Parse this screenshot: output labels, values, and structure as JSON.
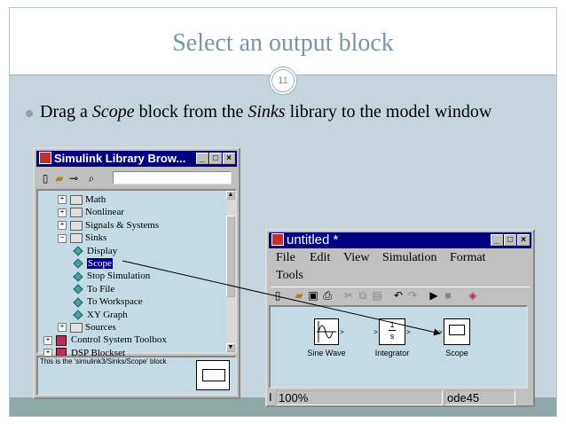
{
  "slide": {
    "title": "Select an output block",
    "page_number": "11",
    "bullet_prefix": "Drag a ",
    "bullet_italic1": "Scope",
    "bullet_mid": " block from the ",
    "bullet_italic2": "Sinks",
    "bullet_suffix": " library to the model window",
    "colors": {
      "title": "#7a96a5",
      "body_bg": "#c6d5dd",
      "footer": "#8fa9a9",
      "accent": "#000080"
    }
  },
  "library_browser": {
    "title": "Simulink Library Brow...",
    "tree": [
      {
        "label": "Math",
        "expander": "+",
        "indent": 1,
        "icon": "lib-icon"
      },
      {
        "label": "Nonlinear",
        "expander": "+",
        "indent": 1,
        "icon": "lib-icon"
      },
      {
        "label": "Signals & Systems",
        "expander": "+",
        "indent": 1,
        "icon": "lib-icon"
      },
      {
        "label": "Sinks",
        "expander": "−",
        "indent": 1,
        "icon": "lib-icon"
      },
      {
        "label": "Display",
        "expander": "",
        "indent": 2,
        "icon": "diamond"
      },
      {
        "label": "Scope",
        "expander": "",
        "indent": 2,
        "icon": "diamond",
        "selected": true
      },
      {
        "label": "Stop Simulation",
        "expander": "",
        "indent": 2,
        "icon": "diamond"
      },
      {
        "label": "To File",
        "expander": "",
        "indent": 2,
        "icon": "diamond"
      },
      {
        "label": "To Workspace",
        "expander": "",
        "indent": 2,
        "icon": "diamond"
      },
      {
        "label": "XY Graph",
        "expander": "",
        "indent": 2,
        "icon": "diamond"
      },
      {
        "label": "Sources",
        "expander": "+",
        "indent": 1,
        "icon": "lib-icon"
      },
      {
        "label": "Control System Toolbox",
        "expander": "+",
        "indent": 0,
        "icon": "toolbox-icon"
      },
      {
        "label": "DSP Blockset",
        "expander": "+",
        "indent": 0,
        "icon": "toolbox-icon"
      }
    ],
    "status": "This is the 'simulink3/Sinks/Scope' block"
  },
  "model_window": {
    "title": "untitled *",
    "menus": [
      "File",
      "Edit",
      "View",
      "Simulation",
      "Format",
      "Tools"
    ],
    "blocks": {
      "sine": "Sine Wave",
      "integrator": "Integrator",
      "integrator_num": "1",
      "integrator_den": "s",
      "scope": "Scope"
    },
    "status": {
      "zoom": "100%",
      "solver": "ode45",
      "left": "I"
    }
  }
}
